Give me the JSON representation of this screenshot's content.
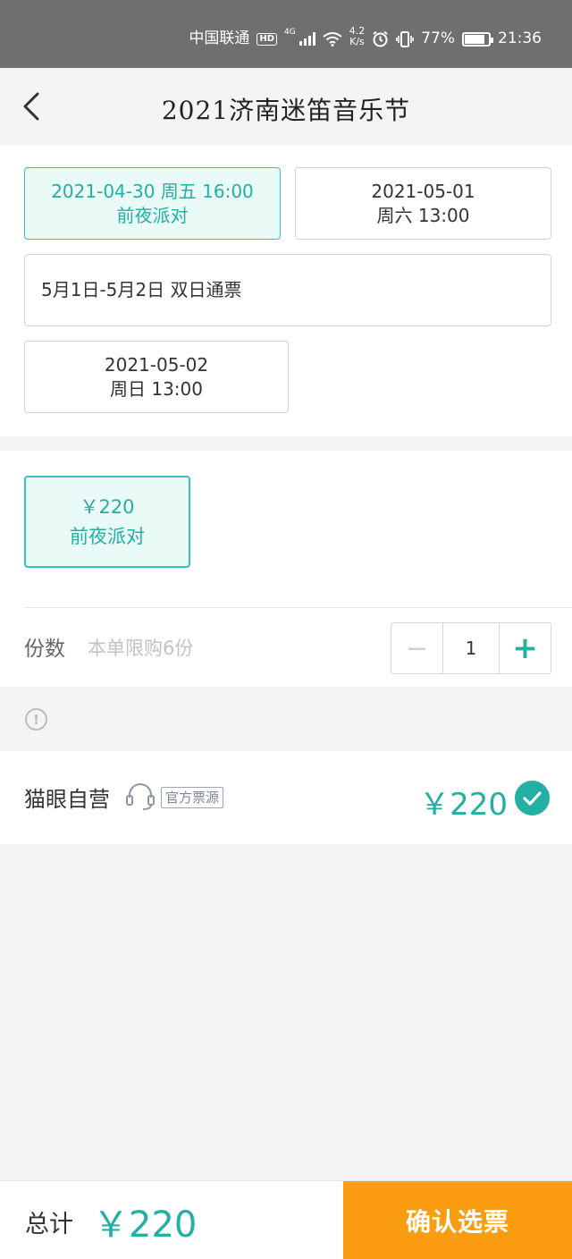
{
  "status_bar": {
    "carrier": "中国联通",
    "hd": "HD",
    "network": "4G",
    "speed_value": "4.2",
    "speed_unit": "K/s",
    "battery": "77%",
    "time": "21:36"
  },
  "nav": {
    "title": "2021济南迷笛音乐节"
  },
  "sessions": [
    {
      "line1": "2021-04-30 周五 16:00",
      "line2": "前夜派对",
      "selected": true
    },
    {
      "line1": "2021-05-01",
      "line2": "周六 13:00",
      "selected": false
    },
    {
      "line1": "5月1日-5月2日 双日通票",
      "line2": "",
      "selected": false
    },
    {
      "line1": "2021-05-02",
      "line2": "周日 13:00",
      "selected": false
    }
  ],
  "price_options": [
    {
      "price": "￥220",
      "label": "前夜派对",
      "selected": true
    }
  ],
  "quantity": {
    "label": "份数",
    "hint": "本单限购6份",
    "value": "1",
    "minus": "−",
    "plus": "+"
  },
  "info_icon": "!",
  "seller": {
    "name": "猫眼自营",
    "tag": "官方票源",
    "price": "￥220",
    "selected": true
  },
  "footer": {
    "total_label": "总计",
    "total_price": "￥220",
    "confirm_label": "确认选票"
  },
  "colors": {
    "accent": "#21b0a2",
    "accent_border": "#39c3b4",
    "selected_bg": "#e9faf7",
    "confirm": "#fb9d10",
    "status_bar": "#6f6f6f"
  },
  "icons": [
    "back-arrow-icon",
    "signal-icon",
    "wifi-icon",
    "alarm-icon",
    "vibrate-icon",
    "battery-icon",
    "info-icon",
    "headset-icon",
    "checkmark-icon"
  ]
}
